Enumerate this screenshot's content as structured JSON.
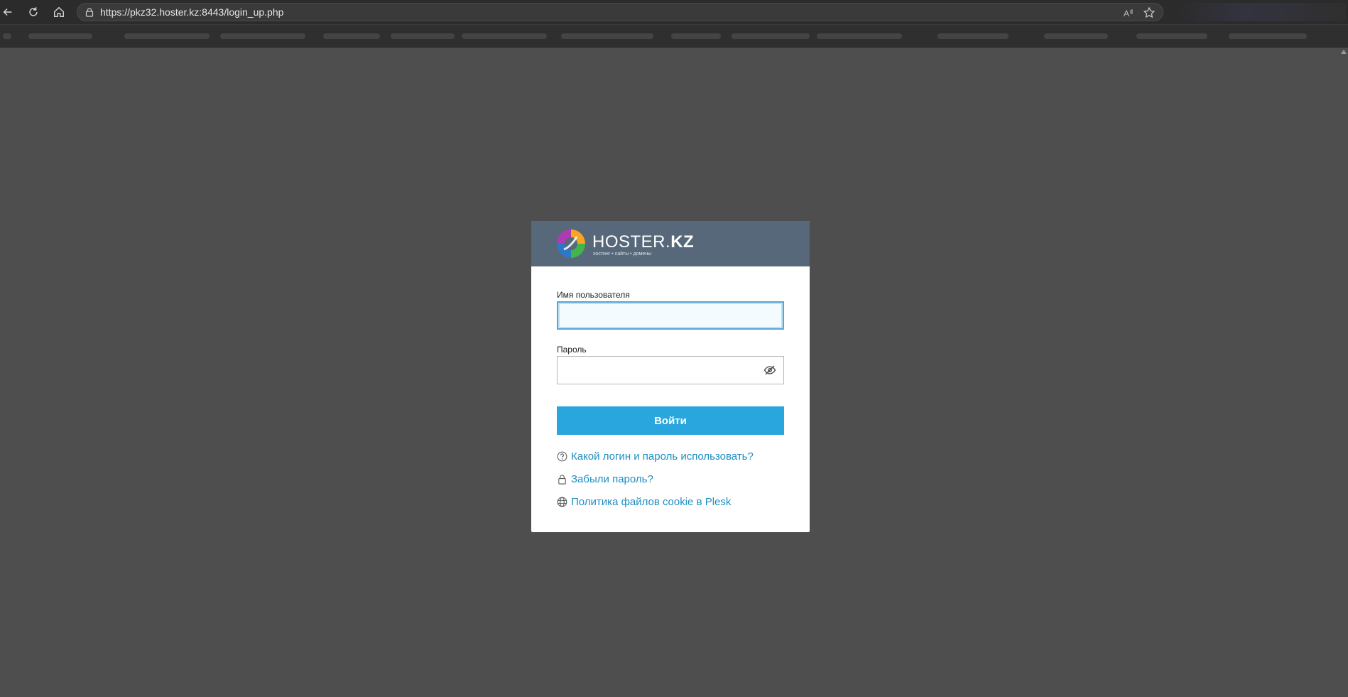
{
  "browser": {
    "url": "https://pkz32.hoster.kz:8443/login_up.php",
    "back_icon": "back-arrow-icon",
    "reload_icon": "reload-icon",
    "home_icon": "home-icon",
    "lock_icon": "lock-icon",
    "read_aloud_icon": "read-aloud-icon",
    "favorite_icon": "star-icon"
  },
  "brand": {
    "name_regular": "HOSTER.",
    "name_bold": "KZ",
    "tagline": "хостинг • сайты • домены",
    "header_color": "#56687a"
  },
  "form": {
    "username_label": "Имя пользователя",
    "username_value": "",
    "password_label": "Пароль",
    "password_value": "",
    "submit_label": "Войти",
    "accent_color": "#2aa6de"
  },
  "links": [
    {
      "icon": "question-circle-icon",
      "label": "Какой логин и пароль использовать?"
    },
    {
      "icon": "lock-icon",
      "label": "Забыли пароль?"
    },
    {
      "icon": "globe-icon",
      "label": "Политика файлов cookie в Plesk"
    }
  ]
}
